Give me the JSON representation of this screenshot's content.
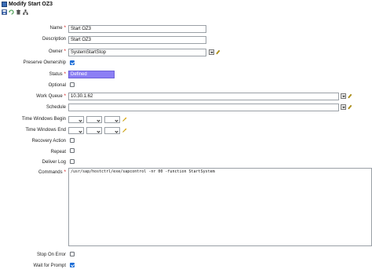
{
  "window": {
    "title": "Modify Start OZ3"
  },
  "toolbar": {
    "icons": [
      "save-icon",
      "refresh-icon",
      "delete-icon",
      "hierarchy-icon"
    ]
  },
  "form": {
    "name": {
      "label": "Name",
      "required": "*",
      "value": "Start OZ3"
    },
    "description": {
      "label": "Description",
      "value": "Start OZ3"
    },
    "owner": {
      "label": "Owner",
      "required": "*",
      "value": "SystemStartStop"
    },
    "preserve_ownership": {
      "label": "Preserve Ownership",
      "checked": true
    },
    "status": {
      "label": "Status",
      "required": "*",
      "value": "Defined"
    },
    "optional": {
      "label": "Optional",
      "checked": false
    },
    "work_queue": {
      "label": "Work Queue",
      "required": "*",
      "value": "10.30.1.62"
    },
    "schedule": {
      "label": "Schedule",
      "value": ""
    },
    "time_windows_begin": {
      "label": "Time Windows Begin"
    },
    "time_windows_end": {
      "label": "Time Windows End"
    },
    "recovery_action": {
      "label": "Recovery Action",
      "checked": false
    },
    "repeat": {
      "label": "Repeat",
      "checked": false
    },
    "deliver_log": {
      "label": "Deliver Log",
      "checked": false
    },
    "commands": {
      "label": "Commands",
      "required": "*",
      "value": "/usr/sap/hostctrl/exe/sapcontrol -nr 00 -function StartSystem"
    },
    "stop_on_error": {
      "label": "Stop On Error",
      "checked": false
    },
    "wait_for_prompt": {
      "label": "Wait for Prompt",
      "checked": true
    }
  },
  "colors": {
    "status_bg": "#8c7ff5",
    "checkbox_checked": "#1e6ed6",
    "required": "#cc0000"
  }
}
